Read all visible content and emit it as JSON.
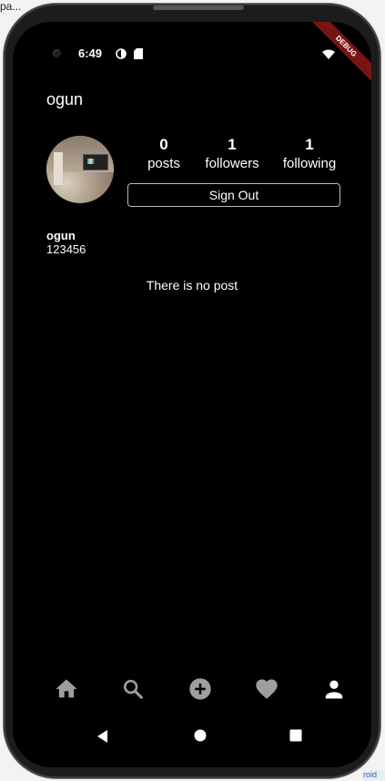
{
  "host": {
    "title": "pa...",
    "corner": "roid"
  },
  "status": {
    "time": "6:49",
    "debug": "DEBUG"
  },
  "profile": {
    "username": "ogun",
    "name": "ogun",
    "bio": "123456",
    "stats": [
      {
        "count": "0",
        "label": "posts"
      },
      {
        "count": "1",
        "label": "followers"
      },
      {
        "count": "1",
        "label": "following"
      }
    ],
    "sign_out_label": "Sign Out",
    "empty_message": "There is no post"
  },
  "bottom_nav": {
    "icons": [
      "home-icon",
      "search-icon",
      "add-circle-icon",
      "favorite-icon",
      "person-icon"
    ],
    "active": "person-icon",
    "inactive_color": "#9e9e9e",
    "active_color": "#ffffff"
  },
  "system_nav": {
    "icons": [
      "back-icon",
      "home-circle-icon",
      "recents-icon"
    ]
  }
}
